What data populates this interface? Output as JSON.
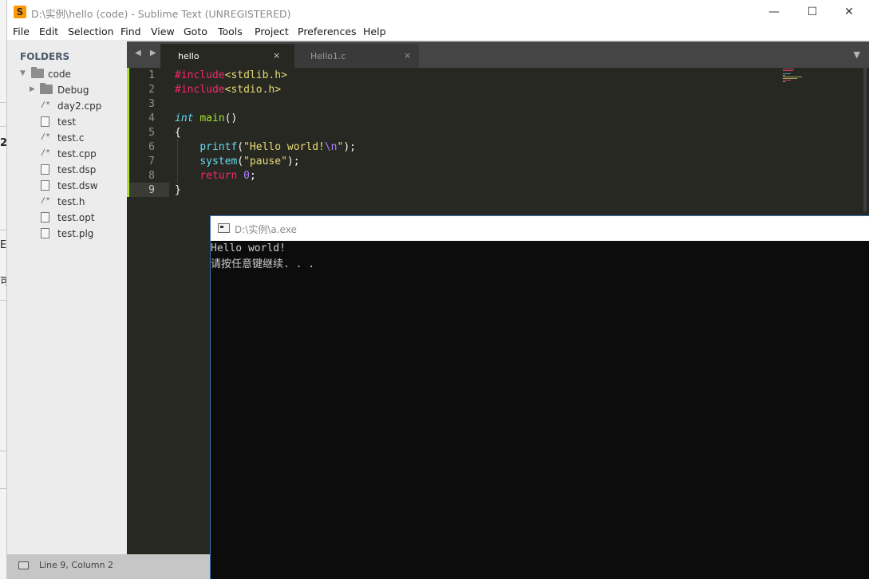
{
  "window": {
    "title": "D:\\实例\\hello (code) - Sublime Text (UNREGISTERED)",
    "app_icon": "S",
    "minimize": "—",
    "maximize": "☐",
    "close": "✕"
  },
  "background_fragments": [
    "2",
    "E",
    "可"
  ],
  "menu": [
    "File",
    "Edit",
    "Selection",
    "Find",
    "View",
    "Goto",
    "Tools",
    "Project",
    "Preferences",
    "Help"
  ],
  "sidebar": {
    "heading": "FOLDERS",
    "root": "code",
    "items": [
      {
        "label": "Debug",
        "kind": "folder"
      },
      {
        "label": "day2.cpp",
        "kind": "code"
      },
      {
        "label": "test",
        "kind": "file"
      },
      {
        "label": "test.c",
        "kind": "code"
      },
      {
        "label": "test.cpp",
        "kind": "code"
      },
      {
        "label": "test.dsp",
        "kind": "file"
      },
      {
        "label": "test.dsw",
        "kind": "file"
      },
      {
        "label": "test.h",
        "kind": "code"
      },
      {
        "label": "test.opt",
        "kind": "file"
      },
      {
        "label": "test.plg",
        "kind": "file"
      }
    ],
    "code_glyph": "/*"
  },
  "tabs": {
    "nav": "◀ ▶",
    "menu": "▼",
    "items": [
      {
        "label": "hello",
        "close": "×",
        "active": true
      },
      {
        "label": "Hello1.c",
        "close": "×",
        "active": false
      }
    ]
  },
  "editor": {
    "line_numbers": [
      "1",
      "2",
      "3",
      "4",
      "5",
      "6",
      "7",
      "8",
      "9"
    ],
    "current_line": 9,
    "lines": [
      {
        "parts": [
          {
            "t": "#include",
            "c": "#f92672"
          },
          {
            "t": "<stdlib.h>",
            "c": "#e6db74"
          }
        ]
      },
      {
        "parts": [
          {
            "t": "#include",
            "c": "#f92672"
          },
          {
            "t": "<stdio.h>",
            "c": "#e6db74"
          }
        ]
      },
      {
        "parts": []
      },
      {
        "parts": [
          {
            "t": "int",
            "c": "#66d9ef",
            "i": true
          },
          {
            "t": " ",
            "c": "#f8f8f2"
          },
          {
            "t": "main",
            "c": "#a6e22e"
          },
          {
            "t": "()",
            "c": "#f8f8f2"
          }
        ]
      },
      {
        "parts": [
          {
            "t": "{",
            "c": "#f8f8f2"
          }
        ]
      },
      {
        "parts": [
          {
            "t": "    ",
            "c": "#f8f8f2"
          },
          {
            "t": "printf",
            "c": "#66d9ef"
          },
          {
            "t": "(",
            "c": "#f8f8f2"
          },
          {
            "t": "\"Hello world!",
            "c": "#e6db74"
          },
          {
            "t": "\\n",
            "c": "#ae81ff"
          },
          {
            "t": "\"",
            "c": "#e6db74"
          },
          {
            "t": ");",
            "c": "#f8f8f2"
          }
        ]
      },
      {
        "parts": [
          {
            "t": "    ",
            "c": "#f8f8f2"
          },
          {
            "t": "system",
            "c": "#66d9ef"
          },
          {
            "t": "(",
            "c": "#f8f8f2"
          },
          {
            "t": "\"pause\"",
            "c": "#e6db74"
          },
          {
            "t": ");",
            "c": "#f8f8f2"
          }
        ]
      },
      {
        "parts": [
          {
            "t": "    ",
            "c": "#f8f8f2"
          },
          {
            "t": "return",
            "c": "#f92672"
          },
          {
            "t": " ",
            "c": "#f8f8f2"
          },
          {
            "t": "0",
            "c": "#ae81ff"
          },
          {
            "t": ";",
            "c": "#f8f8f2"
          }
        ]
      },
      {
        "parts": [
          {
            "t": "}",
            "c": "#f8f8f2"
          }
        ]
      }
    ]
  },
  "status": {
    "position": "Line 9, Column 2"
  },
  "console": {
    "title": "D:\\实例\\a.exe",
    "lines": [
      "Hello world!",
      "请按任意键继续. . ."
    ]
  },
  "colors": {
    "editor_bg": "#272822",
    "accent_green": "#a6e22e",
    "keyword_pink": "#f92672",
    "string_yellow": "#e6db74",
    "type_blue": "#66d9ef",
    "number_purple": "#ae81ff"
  }
}
